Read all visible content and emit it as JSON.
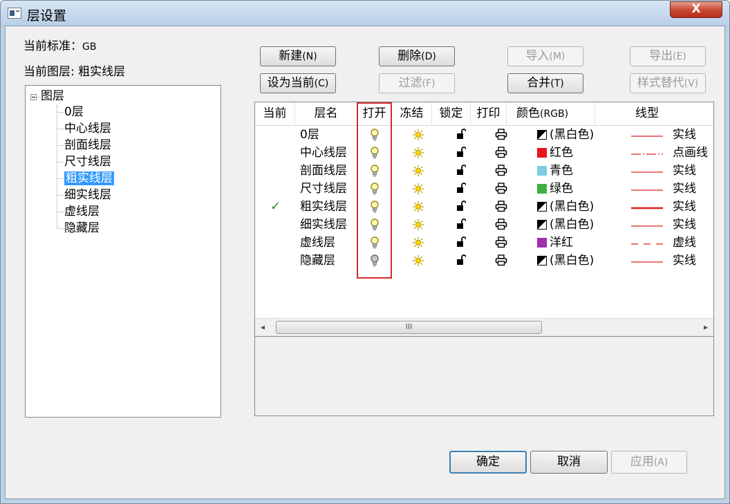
{
  "window": {
    "title": "层设置",
    "close_label": "X"
  },
  "info": {
    "standard_label": "当前标准：",
    "standard_value": "GB",
    "current_layer_label": "当前图层: ",
    "current_layer_value": "粗实线层"
  },
  "tree": {
    "root": "图层",
    "items": [
      "0层",
      "中心线层",
      "剖面线层",
      "尺寸线层",
      "粗实线层",
      "细实线层",
      "虚线层",
      "隐藏层"
    ],
    "selected": "粗实线层"
  },
  "buttons": {
    "new": {
      "label": "新建",
      "acc": "(N)"
    },
    "delete": {
      "label": "删除",
      "acc": "(D)"
    },
    "import": {
      "label": "导入",
      "acc": "(M)"
    },
    "export": {
      "label": "导出",
      "acc": "(E)"
    },
    "set_current": {
      "label": "设为当前",
      "acc": "(C)"
    },
    "filter": {
      "label": "过滤",
      "acc": "(F)"
    },
    "merge": {
      "label": "合并",
      "acc": "(T)"
    },
    "style_replace": {
      "label": "样式替代",
      "acc": "(V)"
    },
    "ok": "确定",
    "cancel": "取消",
    "apply": {
      "label": "应用",
      "acc": "(A)"
    }
  },
  "table": {
    "headers": {
      "current": "当前",
      "name": "层名",
      "on": "打开",
      "freeze": "冻结",
      "lock": "锁定",
      "print": "打印",
      "color": "颜色",
      "color_acc": "(RGB)",
      "linetype": "线型"
    },
    "rows": [
      {
        "current": "",
        "name": "0层",
        "on": true,
        "color_name": "(黑白色)",
        "color": "bw",
        "linetype": "实线",
        "line_style": "solid"
      },
      {
        "current": "",
        "name": "中心线层",
        "on": true,
        "color_name": "红色",
        "color": "#e8141c",
        "linetype": "点画线",
        "line_style": "dashdot"
      },
      {
        "current": "",
        "name": "剖面线层",
        "on": true,
        "color_name": "青色",
        "color": "#7ecbe6",
        "linetype": "实线",
        "line_style": "solid"
      },
      {
        "current": "",
        "name": "尺寸线层",
        "on": true,
        "color_name": "绿色",
        "color": "#3cb043",
        "linetype": "实线",
        "line_style": "solid"
      },
      {
        "current": "✓",
        "name": "粗实线层",
        "on": true,
        "color_name": "(黑白色)",
        "color": "bw",
        "linetype": "实线",
        "line_style": "thick"
      },
      {
        "current": "",
        "name": "细实线层",
        "on": true,
        "color_name": "(黑白色)",
        "color": "bw",
        "linetype": "实线",
        "line_style": "solid"
      },
      {
        "current": "",
        "name": "虚线层",
        "on": true,
        "color_name": "洋红",
        "color": "#a02fb0",
        "linetype": "虚线",
        "line_style": "dashed"
      },
      {
        "current": "",
        "name": "隐藏层",
        "on": false,
        "color_name": "(黑白色)",
        "color": "bw",
        "linetype": "实线",
        "line_style": "solid"
      }
    ]
  },
  "scrollbar": {
    "left_arrow": "◂",
    "right_arrow": "▸",
    "grip": "III"
  }
}
